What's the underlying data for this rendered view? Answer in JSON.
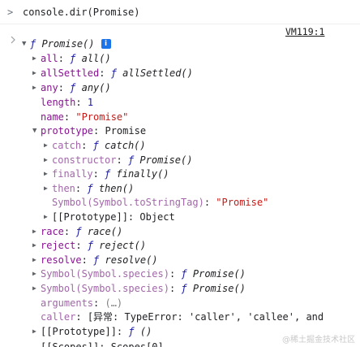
{
  "console": {
    "input_prompt": ">",
    "input_command": "console.dir(Promise)",
    "source_link": "VM119:1"
  },
  "tree": {
    "root": {
      "f": "ƒ",
      "name": "Promise()",
      "info": "i"
    },
    "all": {
      "key": "all",
      "sep": ": ",
      "f": "ƒ",
      "val": "all()"
    },
    "allSettled": {
      "key": "allSettled",
      "sep": ": ",
      "f": "ƒ",
      "val": "allSettled()"
    },
    "any": {
      "key": "any",
      "sep": ": ",
      "f": "ƒ",
      "val": "any()"
    },
    "length": {
      "key": "length",
      "sep": ": ",
      "val": "1"
    },
    "name": {
      "key": "name",
      "sep": ": ",
      "val": "\"Promise\""
    },
    "prototype": {
      "key": "prototype",
      "sep": ": ",
      "val": "Promise"
    },
    "catch": {
      "key": "catch",
      "sep": ": ",
      "f": "ƒ",
      "val": "catch()"
    },
    "constructor": {
      "key": "constructor",
      "sep": ": ",
      "f": "ƒ",
      "val": "Promise()"
    },
    "finally": {
      "key": "finally",
      "sep": ": ",
      "f": "ƒ",
      "val": "finally()"
    },
    "then": {
      "key": "then",
      "sep": ": ",
      "f": "ƒ",
      "val": "then()"
    },
    "toStringTag": {
      "key": "Symbol(Symbol.toStringTag)",
      "sep": ": ",
      "val": "\"Promise\""
    },
    "protoProto": {
      "key": "[[Prototype]]",
      "sep": ": ",
      "val": "Object"
    },
    "race": {
      "key": "race",
      "sep": ": ",
      "f": "ƒ",
      "val": "race()"
    },
    "reject": {
      "key": "reject",
      "sep": ": ",
      "f": "ƒ",
      "val": "reject()"
    },
    "resolve": {
      "key": "resolve",
      "sep": ": ",
      "f": "ƒ",
      "val": "resolve()"
    },
    "species1": {
      "key": "Symbol(Symbol.species)",
      "sep": ": ",
      "f": "ƒ",
      "val": "Promise()"
    },
    "species2": {
      "key": "Symbol(Symbol.species)",
      "sep": ": ",
      "f": "ƒ",
      "val": "Promise()"
    },
    "arguments": {
      "key": "arguments",
      "sep": ": ",
      "val": "(…)"
    },
    "caller": {
      "key": "caller",
      "sep": ": ",
      "val": "[异常: TypeError: 'caller', 'callee', and"
    },
    "rootProto": {
      "key": "[[Prototype]]",
      "sep": ": ",
      "f": "ƒ",
      "val": "()"
    },
    "scopes_partial": {
      "key": "[[Scopes]]: Scopes[0]"
    }
  },
  "watermark": "@稀土掘金技术社区"
}
